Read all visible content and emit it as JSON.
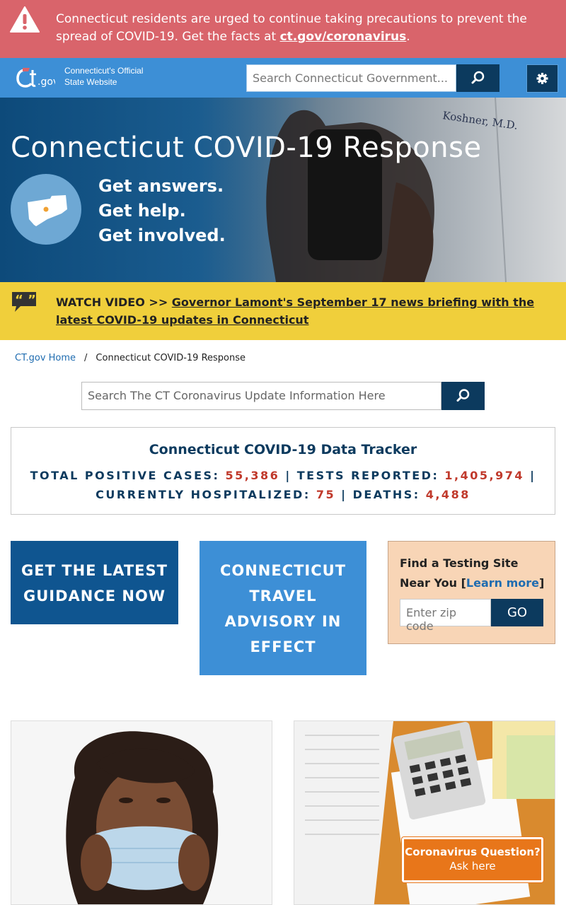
{
  "alert": {
    "text": "Connecticut residents are urged to continue taking precautions to prevent the spread of COVID-19. Get the facts at ",
    "link": "ct.gov/coronavirus",
    "suffix": ".",
    "color": "#d9646b"
  },
  "header": {
    "logo": "ct.gov",
    "tagline_line1": "Connecticut's Official",
    "tagline_line2": "State Website",
    "search_placeholder": "Search Connecticut Government...",
    "color": "#3d8fd6"
  },
  "hero": {
    "title": "Connecticut COVID-19 Response",
    "line1": "Get answers.",
    "line2": "Get help.",
    "line3": "Get involved.",
    "coat_text": "Koshner, M.D."
  },
  "video_banner": {
    "prefix": "WATCH VIDEO >> ",
    "link": "Governor Lamont's September 17 news briefing with the latest COVID-19 updates in Connecticut",
    "color": "#f0cf3b"
  },
  "breadcrumb": {
    "home": "CT.gov Home",
    "separator": "/",
    "current": "Connecticut COVID-19 Response"
  },
  "main_search": {
    "placeholder": "Search The CT Coronavirus Update Information Here"
  },
  "tracker": {
    "title": "Connecticut COVID-19 Data Tracker",
    "cases_label": "TOTAL POSITIVE CASES: ",
    "cases_value": "55,386",
    "tests_label": "TESTS REPORTED: ",
    "tests_value": "1,405,974",
    "hosp_label": "CURRENTLY HOSPITALIZED: ",
    "hosp_value": "75",
    "deaths_label": "DEATHS: ",
    "deaths_value": "4,488",
    "divider": " | "
  },
  "cards": {
    "guidance_line1": "GET THE LATEST",
    "guidance_line2": "GUIDANCE NOW",
    "travel_line1": "CONNECTICUT",
    "travel_line2": "TRAVEL",
    "travel_line3": "ADVISORY IN",
    "travel_line4": "EFFECT",
    "testing_title": "Find a Testing Site Near You ",
    "testing_open": "[",
    "testing_link": "Learn more",
    "testing_close": "]",
    "zip_placeholder": "Enter zip code",
    "go_label": "GO"
  },
  "chat": {
    "title": "Coronavirus Question?",
    "subtitle": "Ask here",
    "color": "#e8761a"
  },
  "icons": [
    "warning-icon",
    "search-icon",
    "gear-icon",
    "connecticut-map-icon",
    "quote-icon"
  ]
}
